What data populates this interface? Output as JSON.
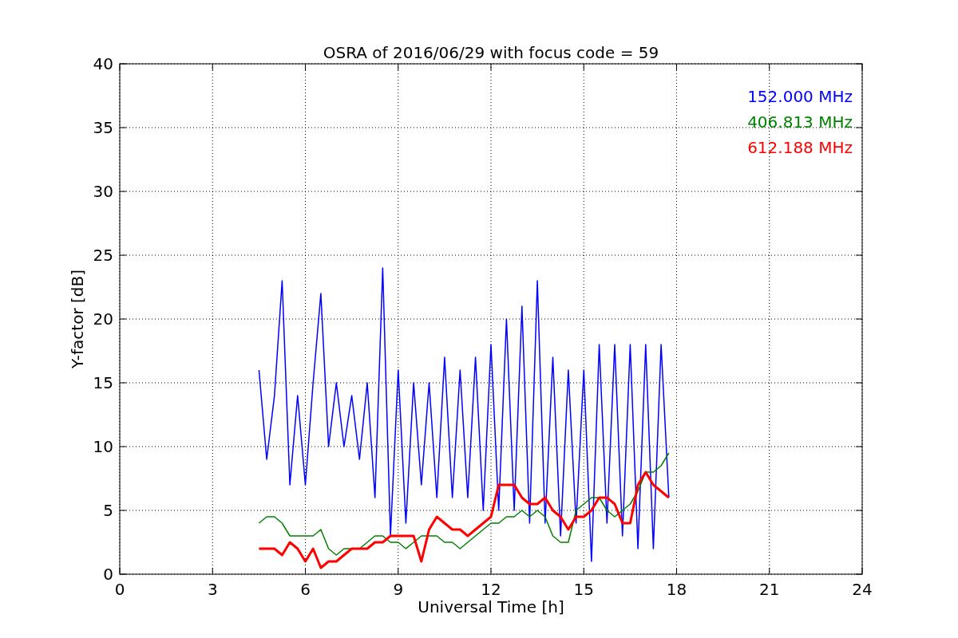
{
  "figure": {
    "chart_data": {
      "type": "line",
      "title": "OSRA of 2016/06/29 with focus code = 59",
      "xlabel": "Universal Time [h]",
      "ylabel": "Y-factor [dB]",
      "x": [
        4.5,
        4.75,
        5.0,
        5.25,
        5.5,
        5.75,
        6.0,
        6.25,
        6.5,
        6.75,
        7.0,
        7.25,
        7.5,
        7.75,
        8.0,
        8.25,
        8.5,
        8.75,
        9.0,
        9.25,
        9.5,
        9.75,
        10.0,
        10.25,
        10.5,
        10.75,
        11.0,
        11.25,
        11.5,
        11.75,
        12.0,
        12.25,
        12.5,
        12.75,
        13.0,
        13.25,
        13.5,
        13.75,
        14.0,
        14.25,
        14.5,
        14.75,
        15.0,
        15.25,
        15.5,
        15.75,
        16.0,
        16.25,
        16.5,
        16.75,
        17.0,
        17.25,
        17.5,
        17.75
      ],
      "series": [
        {
          "name": "152.000 MHz",
          "color": "#0000ff",
          "values": [
            16,
            9,
            14,
            23,
            7,
            14,
            7,
            15,
            22,
            10,
            15,
            10,
            14,
            9,
            15,
            6,
            24,
            3,
            16,
            4,
            15,
            7,
            15,
            6,
            17,
            6,
            16,
            6,
            17,
            5,
            18,
            5,
            20,
            5,
            21,
            4,
            23,
            4,
            17,
            3,
            16,
            4,
            16,
            1,
            18,
            4,
            18,
            3,
            18,
            2,
            18,
            2,
            18,
            6
          ]
        },
        {
          "name": "406.813 MHz",
          "color": "#008000",
          "values": [
            4,
            4.5,
            4.5,
            4,
            3,
            3,
            3,
            3,
            3.5,
            2,
            1.5,
            2,
            2,
            2,
            2.5,
            3,
            3,
            2.5,
            2.5,
            2,
            2.5,
            3,
            3,
            3,
            2.5,
            2.5,
            2,
            2.5,
            3,
            3.5,
            4,
            4,
            4.5,
            4.5,
            5,
            4.5,
            5,
            4.5,
            3,
            2.5,
            2.5,
            5,
            5.5,
            6,
            6,
            5,
            4.5,
            5,
            5.5,
            6.5,
            8,
            8,
            8.5,
            9.5
          ]
        },
        {
          "name": "612.188 MHz",
          "color": "#ff0000",
          "values": [
            2,
            2,
            2,
            1.5,
            2.5,
            2,
            1,
            2,
            0.5,
            1,
            1,
            1.5,
            2,
            2,
            2,
            2.5,
            2.5,
            3,
            3,
            3,
            3,
            1,
            3.5,
            4.5,
            4,
            3.5,
            3.5,
            3,
            3.5,
            4,
            4.5,
            7,
            7,
            7,
            6,
            5.5,
            5.5,
            6,
            5,
            4.5,
            3.5,
            4.5,
            4.5,
            5,
            6,
            6,
            5.5,
            4,
            4,
            7,
            8,
            7,
            6.5,
            6
          ]
        }
      ],
      "grid": true,
      "xlim": [
        0,
        24
      ],
      "ylim": [
        0,
        40
      ],
      "xticks": [
        0,
        3,
        6,
        9,
        12,
        15,
        18,
        21,
        24
      ],
      "yticks": [
        0,
        5,
        10,
        15,
        20,
        25,
        30,
        35,
        40
      ]
    }
  }
}
